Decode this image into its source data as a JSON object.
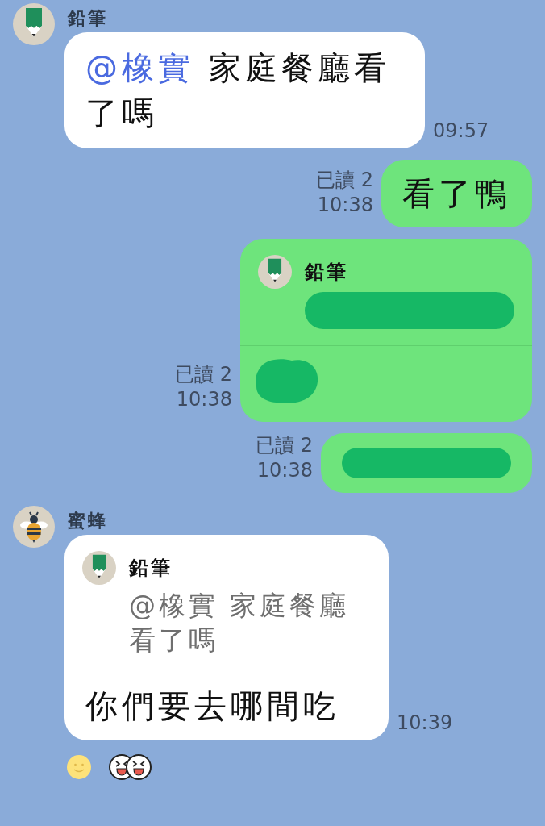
{
  "messages": [
    {
      "kind": "incoming",
      "sender": "鉛筆",
      "avatar": {
        "kind": "pencil"
      },
      "time": "09:57",
      "body": {
        "kind": "text",
        "mention": "@橡實",
        "text": " 家庭餐廳看了嗎"
      }
    },
    {
      "kind": "outgoing",
      "read": "已讀 2",
      "time": "10:38",
      "body": {
        "kind": "text",
        "text": "看了鴨"
      }
    },
    {
      "kind": "outgoing",
      "read": "已讀 2",
      "time": "10:38",
      "quote": {
        "sender": "鉛筆",
        "avatar": {
          "kind": "pencil"
        },
        "body": {
          "kind": "redacted_bar"
        }
      },
      "body": {
        "kind": "redacted_blob"
      }
    },
    {
      "kind": "outgoing",
      "read": "已讀 2",
      "time": "10:38",
      "body": {
        "kind": "redacted_bar"
      }
    },
    {
      "kind": "incoming",
      "sender": "蜜蜂",
      "avatar": {
        "kind": "bee"
      },
      "time": "10:39",
      "quote": {
        "sender": "鉛筆",
        "avatar": {
          "kind": "pencil"
        },
        "body": {
          "kind": "text",
          "text": "@橡實 家庭餐廳看了嗎"
        }
      },
      "body": {
        "kind": "text",
        "text": "你們要去哪間吃"
      }
    }
  ],
  "reactions": [
    {
      "kind": "smile"
    },
    {
      "kind": "laugh"
    }
  ]
}
